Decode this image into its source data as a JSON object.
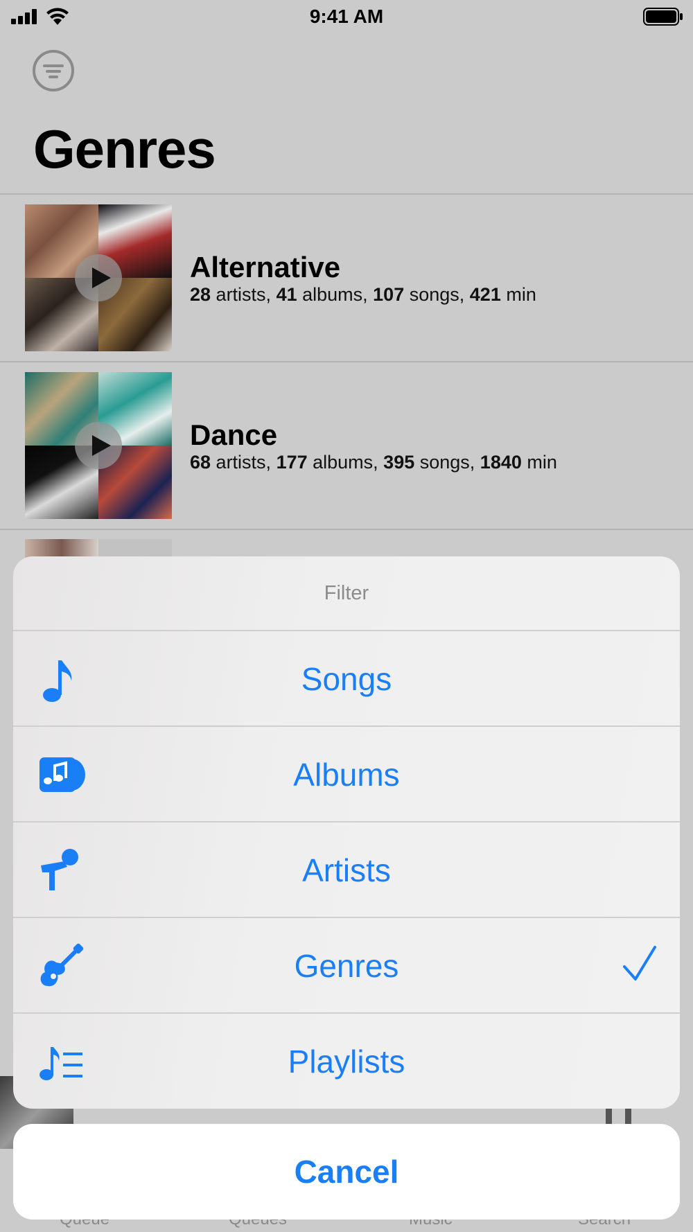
{
  "status_bar": {
    "time": "9:41 AM"
  },
  "page": {
    "title": "Genres"
  },
  "genres": [
    {
      "name": "Alternative",
      "stats": [
        {
          "value": "28",
          "unit": " artists, "
        },
        {
          "value": "41",
          "unit": " albums, "
        },
        {
          "value": "107",
          "unit": " songs, "
        },
        {
          "value": "421",
          "unit": " min"
        }
      ]
    },
    {
      "name": "Dance",
      "stats": [
        {
          "value": "68",
          "unit": " artists, "
        },
        {
          "value": "177",
          "unit": " albums, "
        },
        {
          "value": "395",
          "unit": " songs, "
        },
        {
          "value": "1840",
          "unit": " min"
        }
      ]
    }
  ],
  "action_sheet": {
    "title": "Filter",
    "options": [
      {
        "label": "Songs",
        "icon": "music-note-icon",
        "selected": false
      },
      {
        "label": "Albums",
        "icon": "album-icon",
        "selected": false
      },
      {
        "label": "Artists",
        "icon": "microphone-icon",
        "selected": false
      },
      {
        "label": "Genres",
        "icon": "guitar-icon",
        "selected": true
      },
      {
        "label": "Playlists",
        "icon": "playlist-icon",
        "selected": false
      }
    ],
    "cancel_label": "Cancel"
  },
  "tab_bar": {
    "tabs": [
      "Queue",
      "Queues",
      "Music",
      "Search"
    ]
  },
  "colors": {
    "accent": "#1a7ff6",
    "background": "#cbcbcb",
    "sheet": "#f0f0f0"
  }
}
